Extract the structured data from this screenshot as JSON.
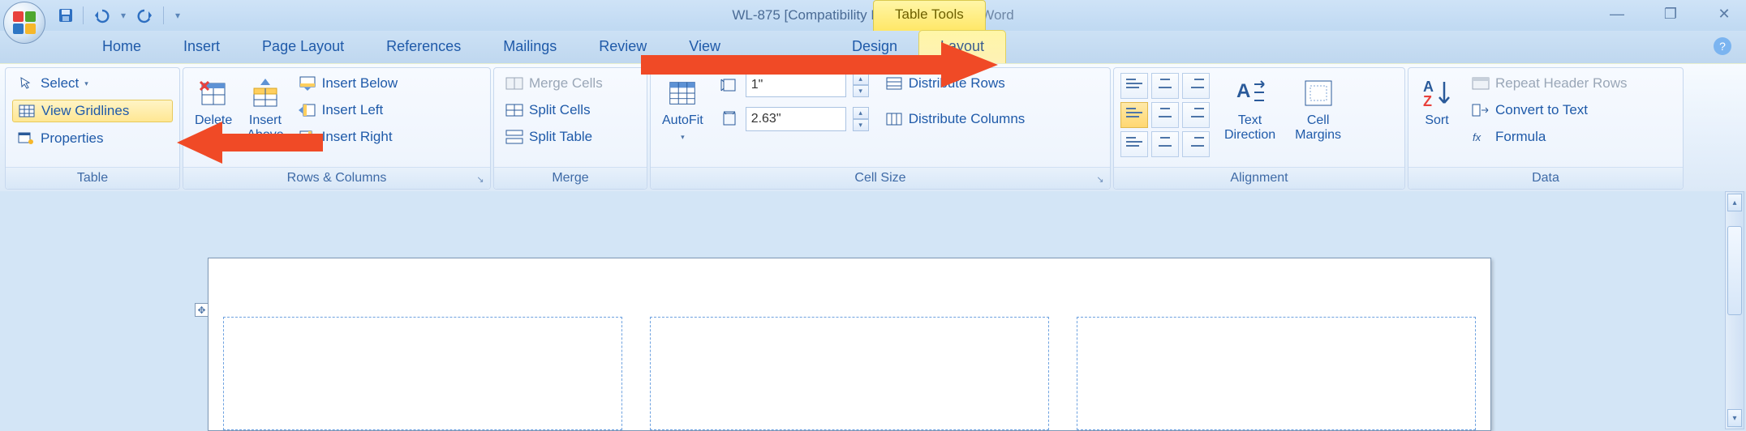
{
  "title": {
    "doc": "WL-875 [Compatibility Mode]",
    "sep": " - ",
    "app": "Microsoft Word"
  },
  "context_tab": "Table Tools",
  "tabs": {
    "home": "Home",
    "insert": "Insert",
    "pagelayout": "Page Layout",
    "references": "References",
    "mailings": "Mailings",
    "review": "Review",
    "view": "View",
    "design": "Design",
    "layout": "Layout"
  },
  "groups": {
    "table": {
      "label": "Table",
      "select": "Select",
      "view_gridlines": "View Gridlines",
      "properties": "Properties"
    },
    "rows": {
      "label": "Rows & Columns",
      "delete": "Delete",
      "insert_above": "Insert\nAbove",
      "insert_below": "Insert Below",
      "insert_left": "Insert Left",
      "insert_right": "Insert Right"
    },
    "merge": {
      "label": "Merge",
      "merge_cells": "Merge Cells",
      "split_cells": "Split Cells",
      "split_table": "Split Table"
    },
    "cellsize": {
      "label": "Cell Size",
      "autofit": "AutoFit",
      "height": "1\"",
      "width": "2.63\"",
      "dist_rows": "Distribute Rows",
      "dist_cols": "Distribute Columns"
    },
    "alignment": {
      "label": "Alignment",
      "text_direction": "Text\nDirection",
      "cell_margins": "Cell\nMargins"
    },
    "data": {
      "label": "Data",
      "sort": "Sort",
      "repeat_header": "Repeat Header Rows",
      "convert": "Convert to Text",
      "formula": "Formula"
    }
  }
}
